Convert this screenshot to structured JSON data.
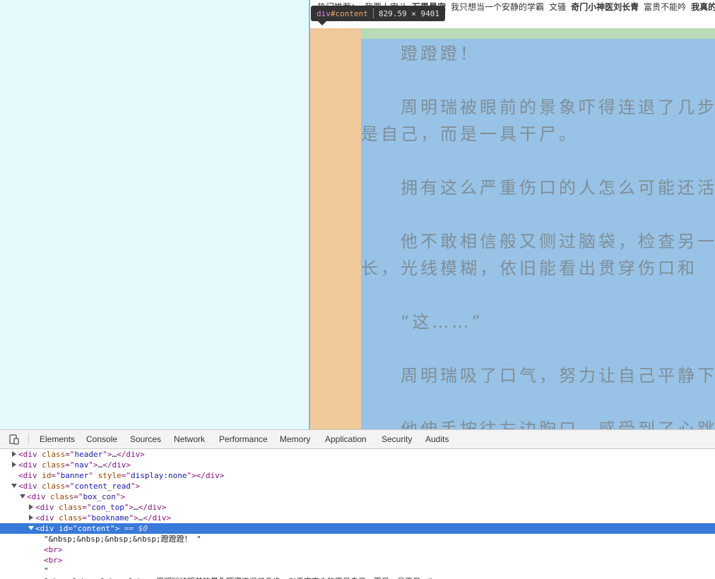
{
  "page": {
    "hot_bar": [
      {
        "text": "热门推荐：",
        "bold": false
      },
      {
        "text": "我要上宫斗",
        "bold": false
      },
      {
        "text": "万界最宠",
        "bold": true
      },
      {
        "text": "我只想当一个安静的学霸",
        "bold": false
      },
      {
        "text": "文骚",
        "bold": false
      },
      {
        "text": "奇门小神医刘长青",
        "bold": true
      },
      {
        "text": "富贵不能吟",
        "bold": false
      },
      {
        "text": "我真的",
        "bold": true
      }
    ],
    "paragraphs": [
      "　　蹬蹬蹬！",
      "　　周明瑞被眼前的景象吓得连退了几步，似乎突变中的不是",
      "是自己，而是一具干尸。",
      "　　拥有这么严重伤口的人怎么可能还活着？",
      "　　他不敢相信般又侧过脑袋，检查另一边太阳穴，那里的伤口",
      "长，光线模糊，依旧能看出贯穿伤口和",
      "　　“这……”",
      "　　周明瑞吸了口气，努力让自己平静下来",
      "　　他伸手按往左边胸口，感受到了心跳"
    ]
  },
  "tooltip": {
    "tag": "div",
    "id": "#content",
    "dimensions": "829.59 × 9401"
  },
  "devtools": {
    "tabs": [
      "Elements",
      "Console",
      "Sources",
      "Network",
      "Performance",
      "Memory",
      "Application",
      "Security",
      "Audits"
    ],
    "active_tab": "Elements",
    "tree": [
      {
        "indent": 0,
        "arrow": "right",
        "parts": [
          [
            "punct",
            "<"
          ],
          [
            "tag-name",
            "div"
          ],
          [
            "attr-name",
            " class"
          ],
          [
            "punct",
            "=\""
          ],
          [
            "attr-val",
            "header"
          ],
          [
            "punct",
            "\">"
          ],
          [
            "text",
            "…"
          ],
          [
            "punct",
            "</"
          ],
          [
            "tag-name",
            "div"
          ],
          [
            "punct",
            ">"
          ]
        ]
      },
      {
        "indent": 0,
        "arrow": "right",
        "parts": [
          [
            "punct",
            "<"
          ],
          [
            "tag-name",
            "div"
          ],
          [
            "attr-name",
            " class"
          ],
          [
            "punct",
            "=\""
          ],
          [
            "attr-val",
            "nav"
          ],
          [
            "punct",
            "\">"
          ],
          [
            "text",
            "…"
          ],
          [
            "punct",
            "</"
          ],
          [
            "tag-name",
            "div"
          ],
          [
            "punct",
            ">"
          ]
        ]
      },
      {
        "indent": 0,
        "arrow": "none",
        "parts": [
          [
            "punct",
            "<"
          ],
          [
            "tag-name",
            "div"
          ],
          [
            "attr-name",
            " id"
          ],
          [
            "punct",
            "=\""
          ],
          [
            "attr-val",
            "banner"
          ],
          [
            "punct",
            "\""
          ],
          [
            "attr-name",
            " style"
          ],
          [
            "punct",
            "=\""
          ],
          [
            "attr-val",
            "display:none"
          ],
          [
            "punct",
            "\"></"
          ],
          [
            "tag-name",
            "div"
          ],
          [
            "punct",
            ">"
          ]
        ]
      },
      {
        "indent": 0,
        "arrow": "down",
        "parts": [
          [
            "punct",
            "<"
          ],
          [
            "tag-name",
            "div"
          ],
          [
            "attr-name",
            " class"
          ],
          [
            "punct",
            "=\""
          ],
          [
            "attr-val",
            "content_read"
          ],
          [
            "punct",
            "\">"
          ]
        ]
      },
      {
        "indent": 1,
        "arrow": "down",
        "parts": [
          [
            "punct",
            "<"
          ],
          [
            "tag-name",
            "div"
          ],
          [
            "attr-name",
            " class"
          ],
          [
            "punct",
            "=\""
          ],
          [
            "attr-val",
            "box_con"
          ],
          [
            "punct",
            "\">"
          ]
        ]
      },
      {
        "indent": 2,
        "arrow": "right",
        "parts": [
          [
            "punct",
            "<"
          ],
          [
            "tag-name",
            "div"
          ],
          [
            "attr-name",
            " class"
          ],
          [
            "punct",
            "=\""
          ],
          [
            "attr-val",
            "con_top"
          ],
          [
            "punct",
            "\">"
          ],
          [
            "text",
            "…"
          ],
          [
            "punct",
            "</"
          ],
          [
            "tag-name",
            "div"
          ],
          [
            "punct",
            ">"
          ]
        ]
      },
      {
        "indent": 2,
        "arrow": "right",
        "parts": [
          [
            "punct",
            "<"
          ],
          [
            "tag-name",
            "div"
          ],
          [
            "attr-name",
            " class"
          ],
          [
            "punct",
            "=\""
          ],
          [
            "attr-val",
            "bookname"
          ],
          [
            "punct",
            "\">"
          ],
          [
            "text",
            "…"
          ],
          [
            "punct",
            "</"
          ],
          [
            "tag-name",
            "div"
          ],
          [
            "punct",
            ">"
          ]
        ]
      },
      {
        "indent": 2,
        "arrow": "down",
        "selected": true,
        "parts": [
          [
            "punct",
            "<"
          ],
          [
            "tag-name",
            "div"
          ],
          [
            "attr-name",
            " id"
          ],
          [
            "punct",
            "=\""
          ],
          [
            "attr-val",
            "content"
          ],
          [
            "punct",
            "\">"
          ],
          [
            "eq0",
            " == $0"
          ]
        ]
      },
      {
        "indent": 3,
        "arrow": "none",
        "parts": [
          [
            "text",
            "\"&nbsp;&nbsp;&nbsp;&nbsp;蹬蹬蹬！ \""
          ]
        ]
      },
      {
        "indent": 3,
        "arrow": "none",
        "parts": [
          [
            "punct",
            "<"
          ],
          [
            "tag-name",
            "br"
          ],
          [
            "punct",
            ">"
          ]
        ]
      },
      {
        "indent": 3,
        "arrow": "none",
        "parts": [
          [
            "punct",
            "<"
          ],
          [
            "tag-name",
            "br"
          ],
          [
            "punct",
            ">"
          ]
        ]
      },
      {
        "indent": 3,
        "arrow": "none",
        "parts": [
          [
            "text",
            "\""
          ]
        ]
      },
      {
        "indent": 3,
        "arrow": "none",
        "parts": [
          [
            "text",
            "&nbsp;&nbsp;&nbsp;&nbsp;周明瑞被眼前的景象吓得连退了几步，似乎突变中的不是自己，而是一具干尸。\""
          ]
        ]
      }
    ]
  },
  "colors": {
    "margin": "#f0c99b",
    "padding": "#b9dbb5",
    "content": "#98c3e6",
    "selected_row": "#3879d9",
    "page_bg": "#e6f9fd"
  }
}
